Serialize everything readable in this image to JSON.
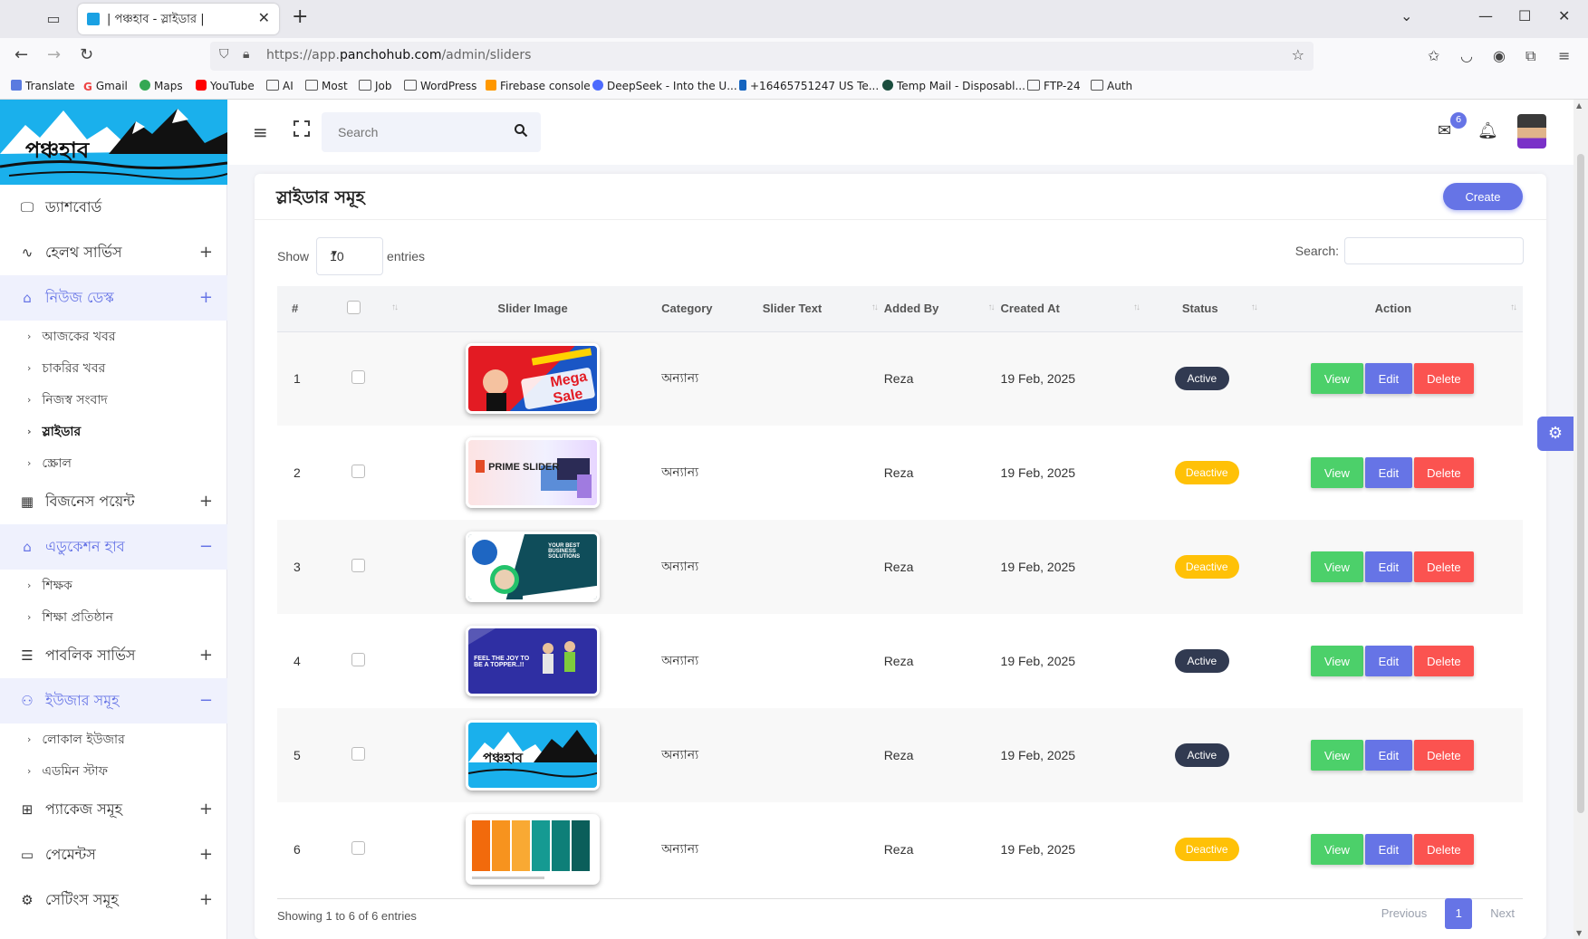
{
  "browser": {
    "tab_title": "| পঞ্চহাব - স্লাইডার |",
    "url_prefix": "https://app.",
    "url_domain": "panchohub.com",
    "url_path": "/admin/sliders",
    "bookmarks": [
      "Translate",
      "Gmail",
      "Maps",
      "YouTube",
      "AI",
      "Most",
      "Job",
      "WordPress",
      "Firebase console",
      "DeepSeek - Into the U...",
      "+16465751247 US Te...",
      "Temp Mail - Disposabl...",
      "FTP-24",
      "Auth"
    ]
  },
  "logo_text": "পঞ্চহাব",
  "sidebar": {
    "items": [
      {
        "label": "ড্যাশবোর্ড",
        "icon": "monitor-icon",
        "toggle": ""
      },
      {
        "label": "হেলথ সার্ভিস",
        "icon": "heartbeat-icon",
        "toggle": "+"
      },
      {
        "label": "নিউজ ডেস্ক",
        "icon": "tag-icon",
        "toggle": "+"
      },
      {
        "label": "বিজনেস পয়েন্ট",
        "icon": "grid-icon",
        "toggle": "+"
      },
      {
        "label": "এডুকেশন হাব",
        "icon": "tags-icon",
        "toggle": "−"
      },
      {
        "label": "পাবলিক সার্ভিস",
        "icon": "server-icon",
        "toggle": "+"
      },
      {
        "label": "ইউজার সমূহ",
        "icon": "users-icon",
        "toggle": "−"
      },
      {
        "label": "প্যাকেজ সমূহ",
        "icon": "gift-icon",
        "toggle": "+"
      },
      {
        "label": "পেমেন্টস",
        "icon": "credit-card-icon",
        "toggle": "+"
      },
      {
        "label": "সেটিংস সমূহ",
        "icon": "gear-icon",
        "toggle": "+"
      }
    ],
    "news_sub": [
      "আজকের খবর",
      "চাকরির খবর",
      "নিজস্ব সংবাদ",
      "স্লাইডার",
      "স্ক্রোল"
    ],
    "edu_sub": [
      "শিক্ষক",
      "শিক্ষা প্রতিষ্ঠান"
    ],
    "user_sub": [
      "লোকাল ইউজার",
      "এডমিন স্টাফ"
    ]
  },
  "header": {
    "search_placeholder": "Search",
    "mail_badge": "6"
  },
  "card": {
    "title": "স্লাইডার সমূহ",
    "create_label": "Create",
    "show_label": "Show",
    "entries_value": "10",
    "entries_label": "entries",
    "search_label": "Search:",
    "columns": [
      "#",
      "Slider Image",
      "Category",
      "Slider Text",
      "Added By",
      "Created At",
      "Status",
      "Action"
    ],
    "rows": [
      {
        "num": "1",
        "category": "অন্যান্য",
        "slider_text": "",
        "added_by": "Reza",
        "created_at": "19 Feb, 2025",
        "status": "Active",
        "thumb": "Mega Sale"
      },
      {
        "num": "2",
        "category": "অন্যান্য",
        "slider_text": "",
        "added_by": "Reza",
        "created_at": "19 Feb, 2025",
        "status": "Deactive",
        "thumb": "PRIME SLIDER"
      },
      {
        "num": "3",
        "category": "অন্যান্য",
        "slider_text": "",
        "added_by": "Reza",
        "created_at": "19 Feb, 2025",
        "status": "Deactive",
        "thumb": "YOUR BEST BUSINESS SOLUTIONS"
      },
      {
        "num": "4",
        "category": "অন্যান্য",
        "slider_text": "",
        "added_by": "Reza",
        "created_at": "19 Feb, 2025",
        "status": "Active",
        "thumb": "FEEL THE JOY TO BE A TOPPER..!!"
      },
      {
        "num": "5",
        "category": "অন্যান্য",
        "slider_text": "",
        "added_by": "Reza",
        "created_at": "19 Feb, 2025",
        "status": "Active",
        "thumb": "পঞ্চহাব"
      },
      {
        "num": "6",
        "category": "অন্যান্য",
        "slider_text": "",
        "added_by": "Reza",
        "created_at": "19 Feb, 2025",
        "status": "Deactive",
        "thumb": ""
      }
    ],
    "actions": {
      "view": "View",
      "edit": "Edit",
      "delete": "Delete"
    },
    "info": "Showing 1 to 6 of 6 entries",
    "pager": {
      "prev": "Previous",
      "current": "1",
      "next": "Next"
    }
  },
  "colors": {
    "accent": "#6674e6",
    "view": "#4cd06a",
    "delete": "#fb5350",
    "active_badge": "#313a51",
    "deactive_badge": "#ffc107",
    "logo_bg": "#1ab0ec"
  }
}
